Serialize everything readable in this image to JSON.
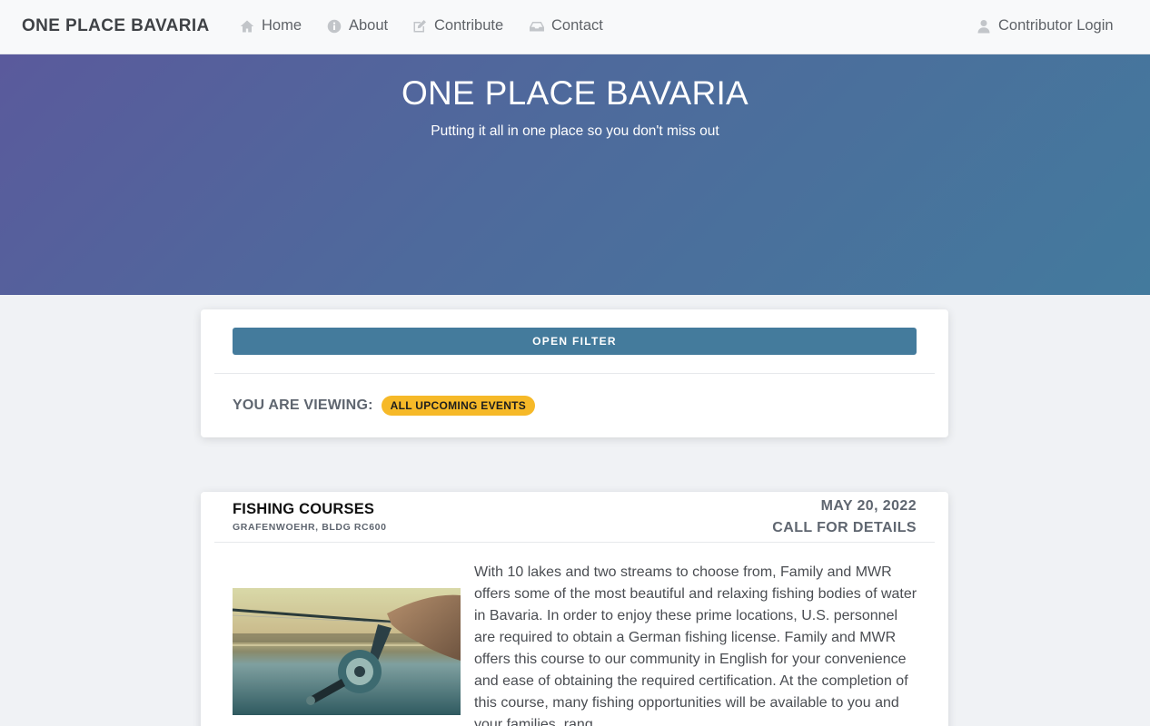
{
  "nav": {
    "brand": "ONE PLACE BAVARIA",
    "items": [
      {
        "label": "Home",
        "icon": "home-icon"
      },
      {
        "label": "About",
        "icon": "info-icon"
      },
      {
        "label": "Contribute",
        "icon": "edit-icon"
      },
      {
        "label": "Contact",
        "icon": "inbox-icon"
      }
    ],
    "login": {
      "label": "Contributor Login",
      "icon": "user-icon"
    }
  },
  "hero": {
    "title": "ONE PLACE BAVARIA",
    "subtitle": "Putting it all in one place so you don't miss out"
  },
  "filter": {
    "button_label": "OPEN FILTER",
    "viewing_label": "YOU ARE VIEWING:",
    "viewing_value": "ALL UPCOMING EVENTS"
  },
  "event": {
    "title": "FISHING COURSES",
    "location": "GRAFENWOEHR, BLDG RC600",
    "date": "MAY 20, 2022",
    "time": "CALL FOR DETAILS",
    "description": "With 10 lakes and two streams to choose from, Family and MWR offers some of the most beautiful and relaxing fishing bodies of water in Bavaria. In order to enjoy these prime locations, U.S. personnel are required to obtain a German fishing license. Family and MWR offers this course to our community in English for your convenience and ease of obtaining the required certification. At the completion of this course, many fishing opportunities will be available to you and your families, rang"
  },
  "colors": {
    "accent": "#447b9c",
    "badge": "#f6b928",
    "hero_start": "#5a5a9c",
    "hero_end": "#437a9d"
  }
}
